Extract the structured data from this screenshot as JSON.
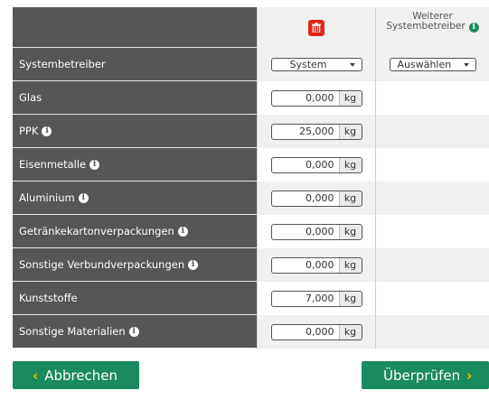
{
  "header": {
    "column2_title_line1": "Weiterer",
    "column2_title_line2": "Systembetreiber"
  },
  "icons": {
    "delete": "trash-icon",
    "info": "info-icon",
    "back": "chevron-left-icon",
    "forward": "chevron-right-icon"
  },
  "rows": [
    {
      "label": "Systembetreiber",
      "type": "select",
      "value": "System",
      "other": "Auswählen",
      "info": false
    },
    {
      "label": "Glas",
      "type": "qty",
      "value": "0,000",
      "unit": "kg",
      "info": false
    },
    {
      "label": "PPK",
      "type": "qty",
      "value": "25,000",
      "unit": "kg",
      "info": true
    },
    {
      "label": "Eisenmetalle",
      "type": "qty",
      "value": "0,000",
      "unit": "kg",
      "info": true
    },
    {
      "label": "Aluminium",
      "type": "qty",
      "value": "0,000",
      "unit": "kg",
      "info": true
    },
    {
      "label": "Getränkekartonverpackungen",
      "type": "qty",
      "value": "0,000",
      "unit": "kg",
      "info": true
    },
    {
      "label": "Sonstige Verbundverpackungen",
      "type": "qty",
      "value": "0,000",
      "unit": "kg",
      "info": true
    },
    {
      "label": "Kunststoffe",
      "type": "qty",
      "value": "7,000",
      "unit": "kg",
      "info": false
    },
    {
      "label": "Sonstige Materialien",
      "type": "qty",
      "value": "0,000",
      "unit": "kg",
      "info": true
    }
  ],
  "buttons": {
    "cancel": "Abbrechen",
    "check": "Überprüfen"
  },
  "colors": {
    "label_bg": "#565656",
    "accent": "#1a8a5f",
    "delete": "#e2231a",
    "chevron": "#f5c400"
  }
}
